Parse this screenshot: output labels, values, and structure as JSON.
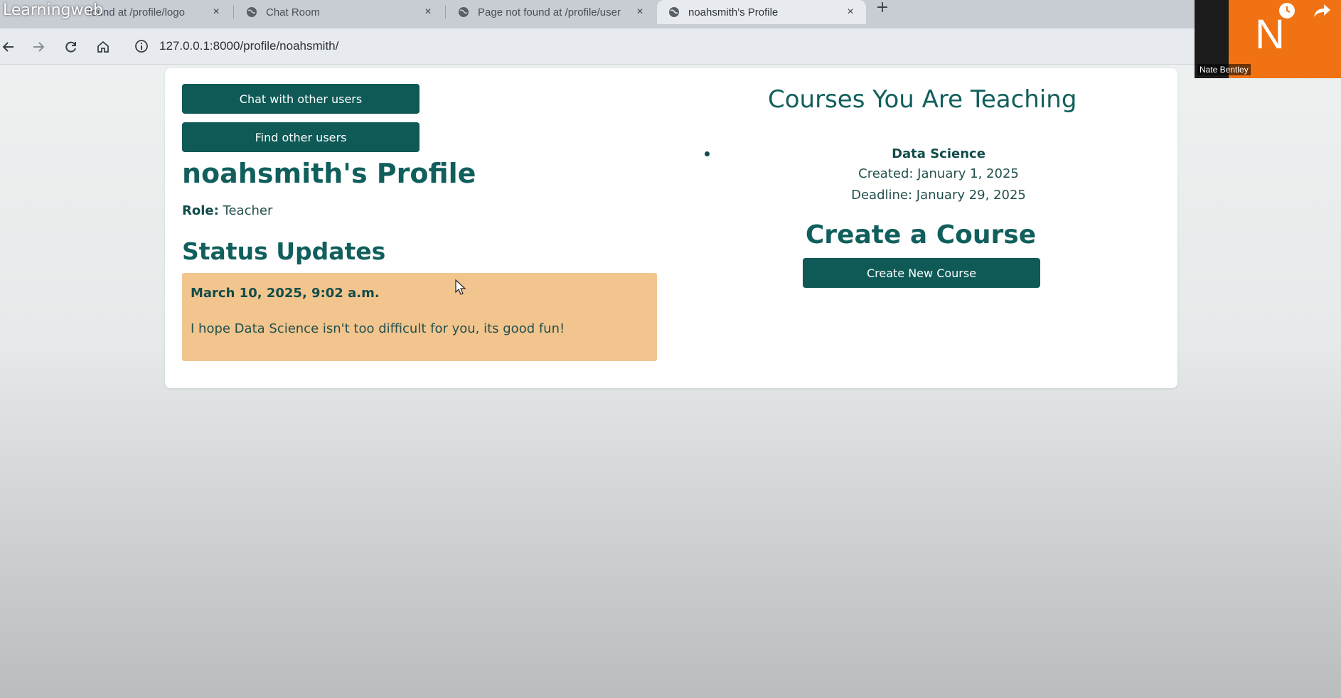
{
  "overlay": {
    "title": "Learningweb"
  },
  "browser": {
    "tabs": [
      {
        "title": "found at /profile/logo",
        "icon": "globe-icon",
        "active": false
      },
      {
        "title": "Chat Room",
        "icon": "globe-icon",
        "active": false
      },
      {
        "title": "Page not found at /profile/user",
        "icon": "globe-icon",
        "active": false
      },
      {
        "title": "noahsmith's Profile",
        "icon": "globe-icon",
        "active": true
      }
    ],
    "close_glyph": "×",
    "new_tab_glyph": "+",
    "url": "127.0.0.1:8000/profile/noahsmith/",
    "nav_icons": [
      "back-arrow-icon",
      "forward-arrow-icon",
      "reload-icon",
      "home-icon",
      "info-icon"
    ]
  },
  "webcam": {
    "letter": "N",
    "name": "Nate Bentley",
    "tile_color": "#f07213"
  },
  "page": {
    "buttons": {
      "chat": "Chat with other users",
      "find": "Find other users",
      "create_course": "Create New Course"
    },
    "profile_title": "noahsmith's Profile",
    "role_label": "Role:",
    "role_value": "Teacher",
    "status_heading": "Status Updates",
    "status_updates": [
      {
        "date": "March 10, 2025, 9:02 a.m.",
        "text": "I hope Data Science isn't too difficult for you, its good fun!"
      }
    ],
    "teaching_heading": "Courses You Are Teaching",
    "courses": [
      {
        "name": "Data Science",
        "created": "Created: January 1, 2025",
        "deadline": "Deadline: January 29, 2025"
      }
    ],
    "create_heading": "Create a Course"
  },
  "colors": {
    "primary": "#0f5a57",
    "heading": "#115f5c",
    "status_bg": "#f2c58e",
    "card_bg": "#ffffff"
  }
}
